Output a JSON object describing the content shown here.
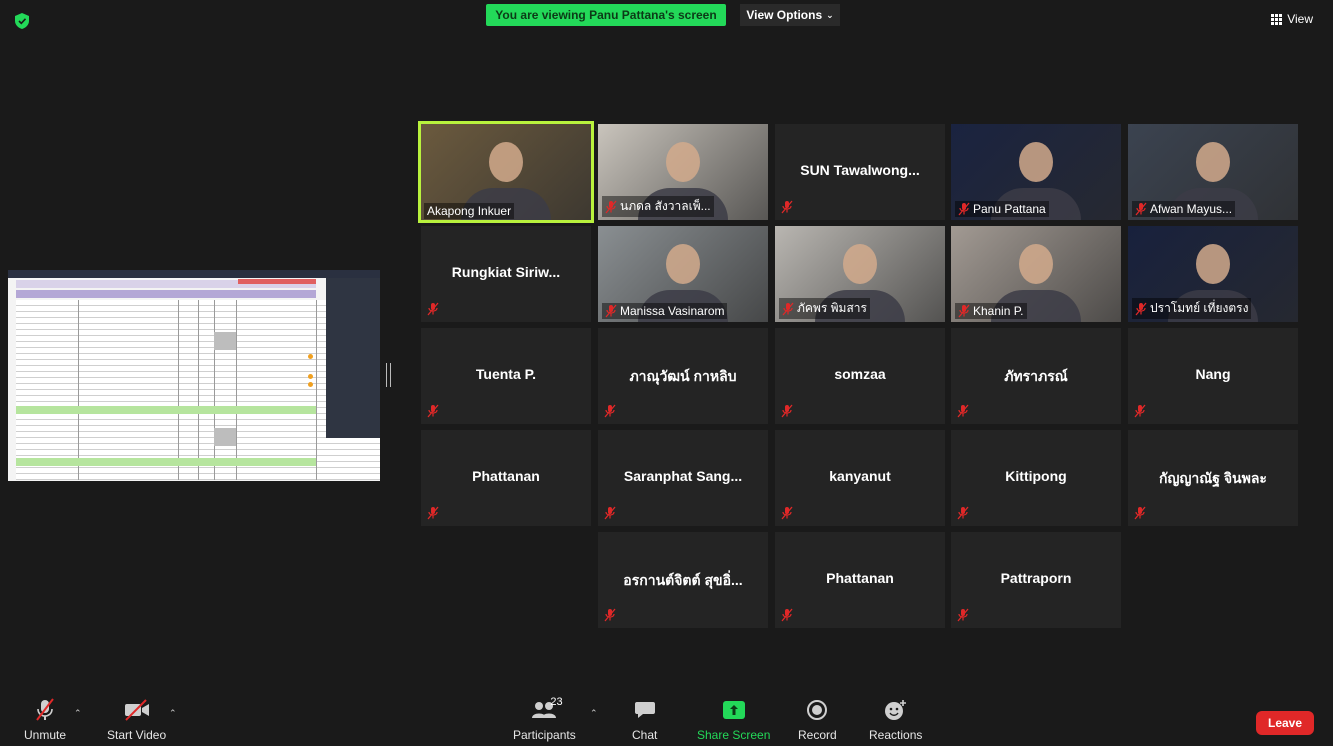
{
  "banner": {
    "text": "You are viewing Panu Pattana's screen"
  },
  "view_options": {
    "label": "View Options"
  },
  "view_button": {
    "label": "View"
  },
  "tiles": [
    {
      "name": "Akapong Inkuer",
      "video": true,
      "active": true
    },
    {
      "name": "นภดล สังวาลเพ็...",
      "video": true
    },
    {
      "name": "SUN Tawalwong...",
      "video": false
    },
    {
      "name": "Panu Pattana",
      "video": true
    },
    {
      "name": "Afwan Mayus...",
      "video": true
    },
    {
      "name": "Rungkiat Siriw...",
      "video": false
    },
    {
      "name": "Manissa Vasinarom",
      "video": true
    },
    {
      "name": "ภัคพร พิมสาร",
      "video": true
    },
    {
      "name": "Khanin P.",
      "video": true
    },
    {
      "name": "ปราโมทย์ เที่ยงตรง",
      "video": true
    },
    {
      "name": "Tuenta P.",
      "video": false
    },
    {
      "name": "ภาณุวัฒน์ กาหลิบ",
      "video": false
    },
    {
      "name": "somzaa",
      "video": false
    },
    {
      "name": "ภัทราภรณ์",
      "video": false
    },
    {
      "name": "Nang",
      "video": false
    },
    {
      "name": "Phattanan",
      "video": false
    },
    {
      "name": "Saranphat Sang...",
      "video": false
    },
    {
      "name": "kanyanut",
      "video": false
    },
    {
      "name": "Kittipong",
      "video": false
    },
    {
      "name": "กัญญาณัฐ จินพละ",
      "video": false
    },
    {
      "name": "อรกานต์จิตต์ สุขอิ่...",
      "video": false
    },
    {
      "name": "Phattanan",
      "video": false
    },
    {
      "name": "Pattraporn",
      "video": false
    }
  ],
  "toolbar": {
    "unmute": "Unmute",
    "start_video": "Start Video",
    "participants": "Participants",
    "participants_count": "23",
    "chat": "Chat",
    "share_screen": "Share Screen",
    "record": "Record",
    "reactions": "Reactions",
    "leave": "Leave"
  },
  "colors": {
    "banner_green": "#23d959",
    "active_border": "#b9f23d",
    "leave_red": "#e02828",
    "mute_red": "#e02828"
  },
  "icons": [
    "shield-icon",
    "grid-icon",
    "muted-mic-icon",
    "video-off-icon",
    "participants-icon",
    "chat-icon",
    "share-screen-icon",
    "record-icon",
    "reactions-icon",
    "chevron-up-icon"
  ]
}
